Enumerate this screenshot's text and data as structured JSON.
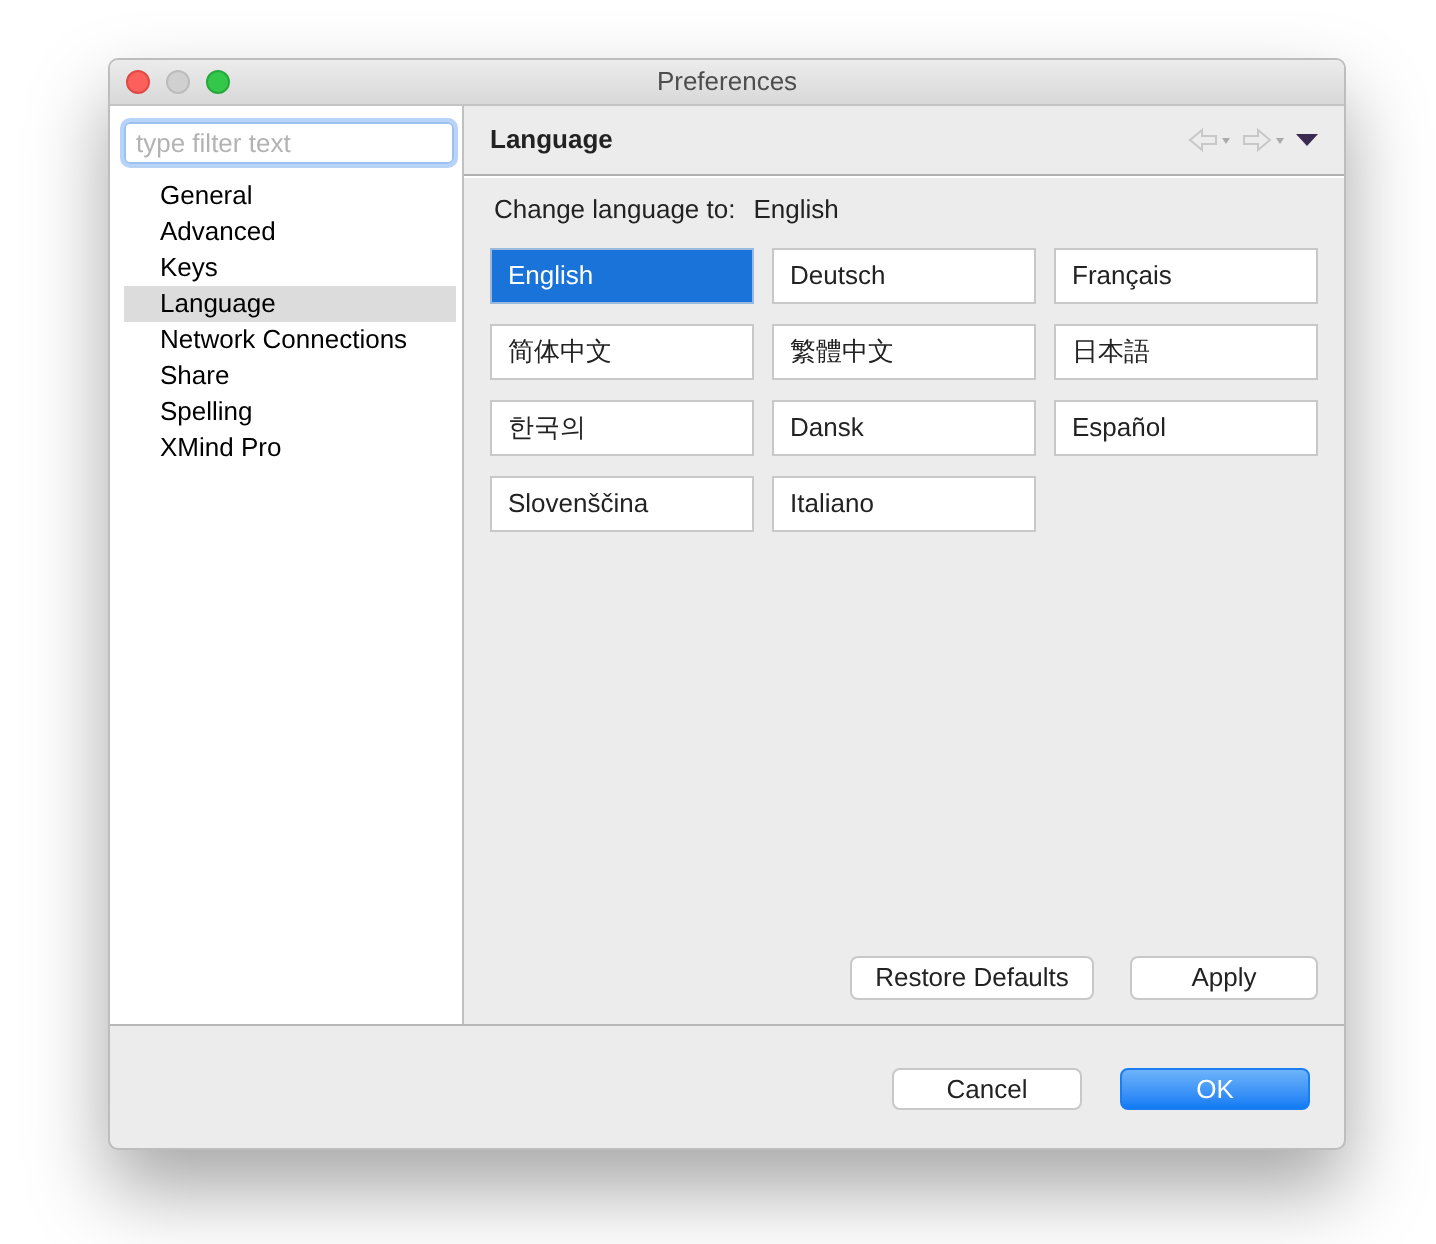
{
  "window": {
    "title": "Preferences"
  },
  "filter": {
    "placeholder": "type filter text"
  },
  "sidebar": {
    "items": [
      {
        "label": "General",
        "selected": false
      },
      {
        "label": "Advanced",
        "selected": false
      },
      {
        "label": "Keys",
        "selected": false
      },
      {
        "label": "Language",
        "selected": true
      },
      {
        "label": "Network Connections",
        "selected": false
      },
      {
        "label": "Share",
        "selected": false
      },
      {
        "label": "Spelling",
        "selected": false
      },
      {
        "label": "XMind Pro",
        "selected": false
      }
    ]
  },
  "page": {
    "title": "Language",
    "current_label": "Change language to:",
    "current_value": "English",
    "languages": [
      {
        "label": "English",
        "selected": true
      },
      {
        "label": "Deutsch",
        "selected": false
      },
      {
        "label": "Français",
        "selected": false
      },
      {
        "label": "简体中文",
        "selected": false
      },
      {
        "label": "繁體中文",
        "selected": false
      },
      {
        "label": "日本語",
        "selected": false
      },
      {
        "label": "한국의",
        "selected": false
      },
      {
        "label": "Dansk",
        "selected": false
      },
      {
        "label": "Español",
        "selected": false
      },
      {
        "label": "Slovenščina",
        "selected": false
      },
      {
        "label": "Italiano",
        "selected": false
      }
    ],
    "buttons": [
      {
        "label": "Restore Defaults",
        "default": false
      },
      {
        "label": "Apply",
        "default": false
      }
    ]
  },
  "footer_buttons": [
    {
      "label": "Cancel",
      "default": false
    },
    {
      "label": "OK",
      "default": true
    }
  ]
}
